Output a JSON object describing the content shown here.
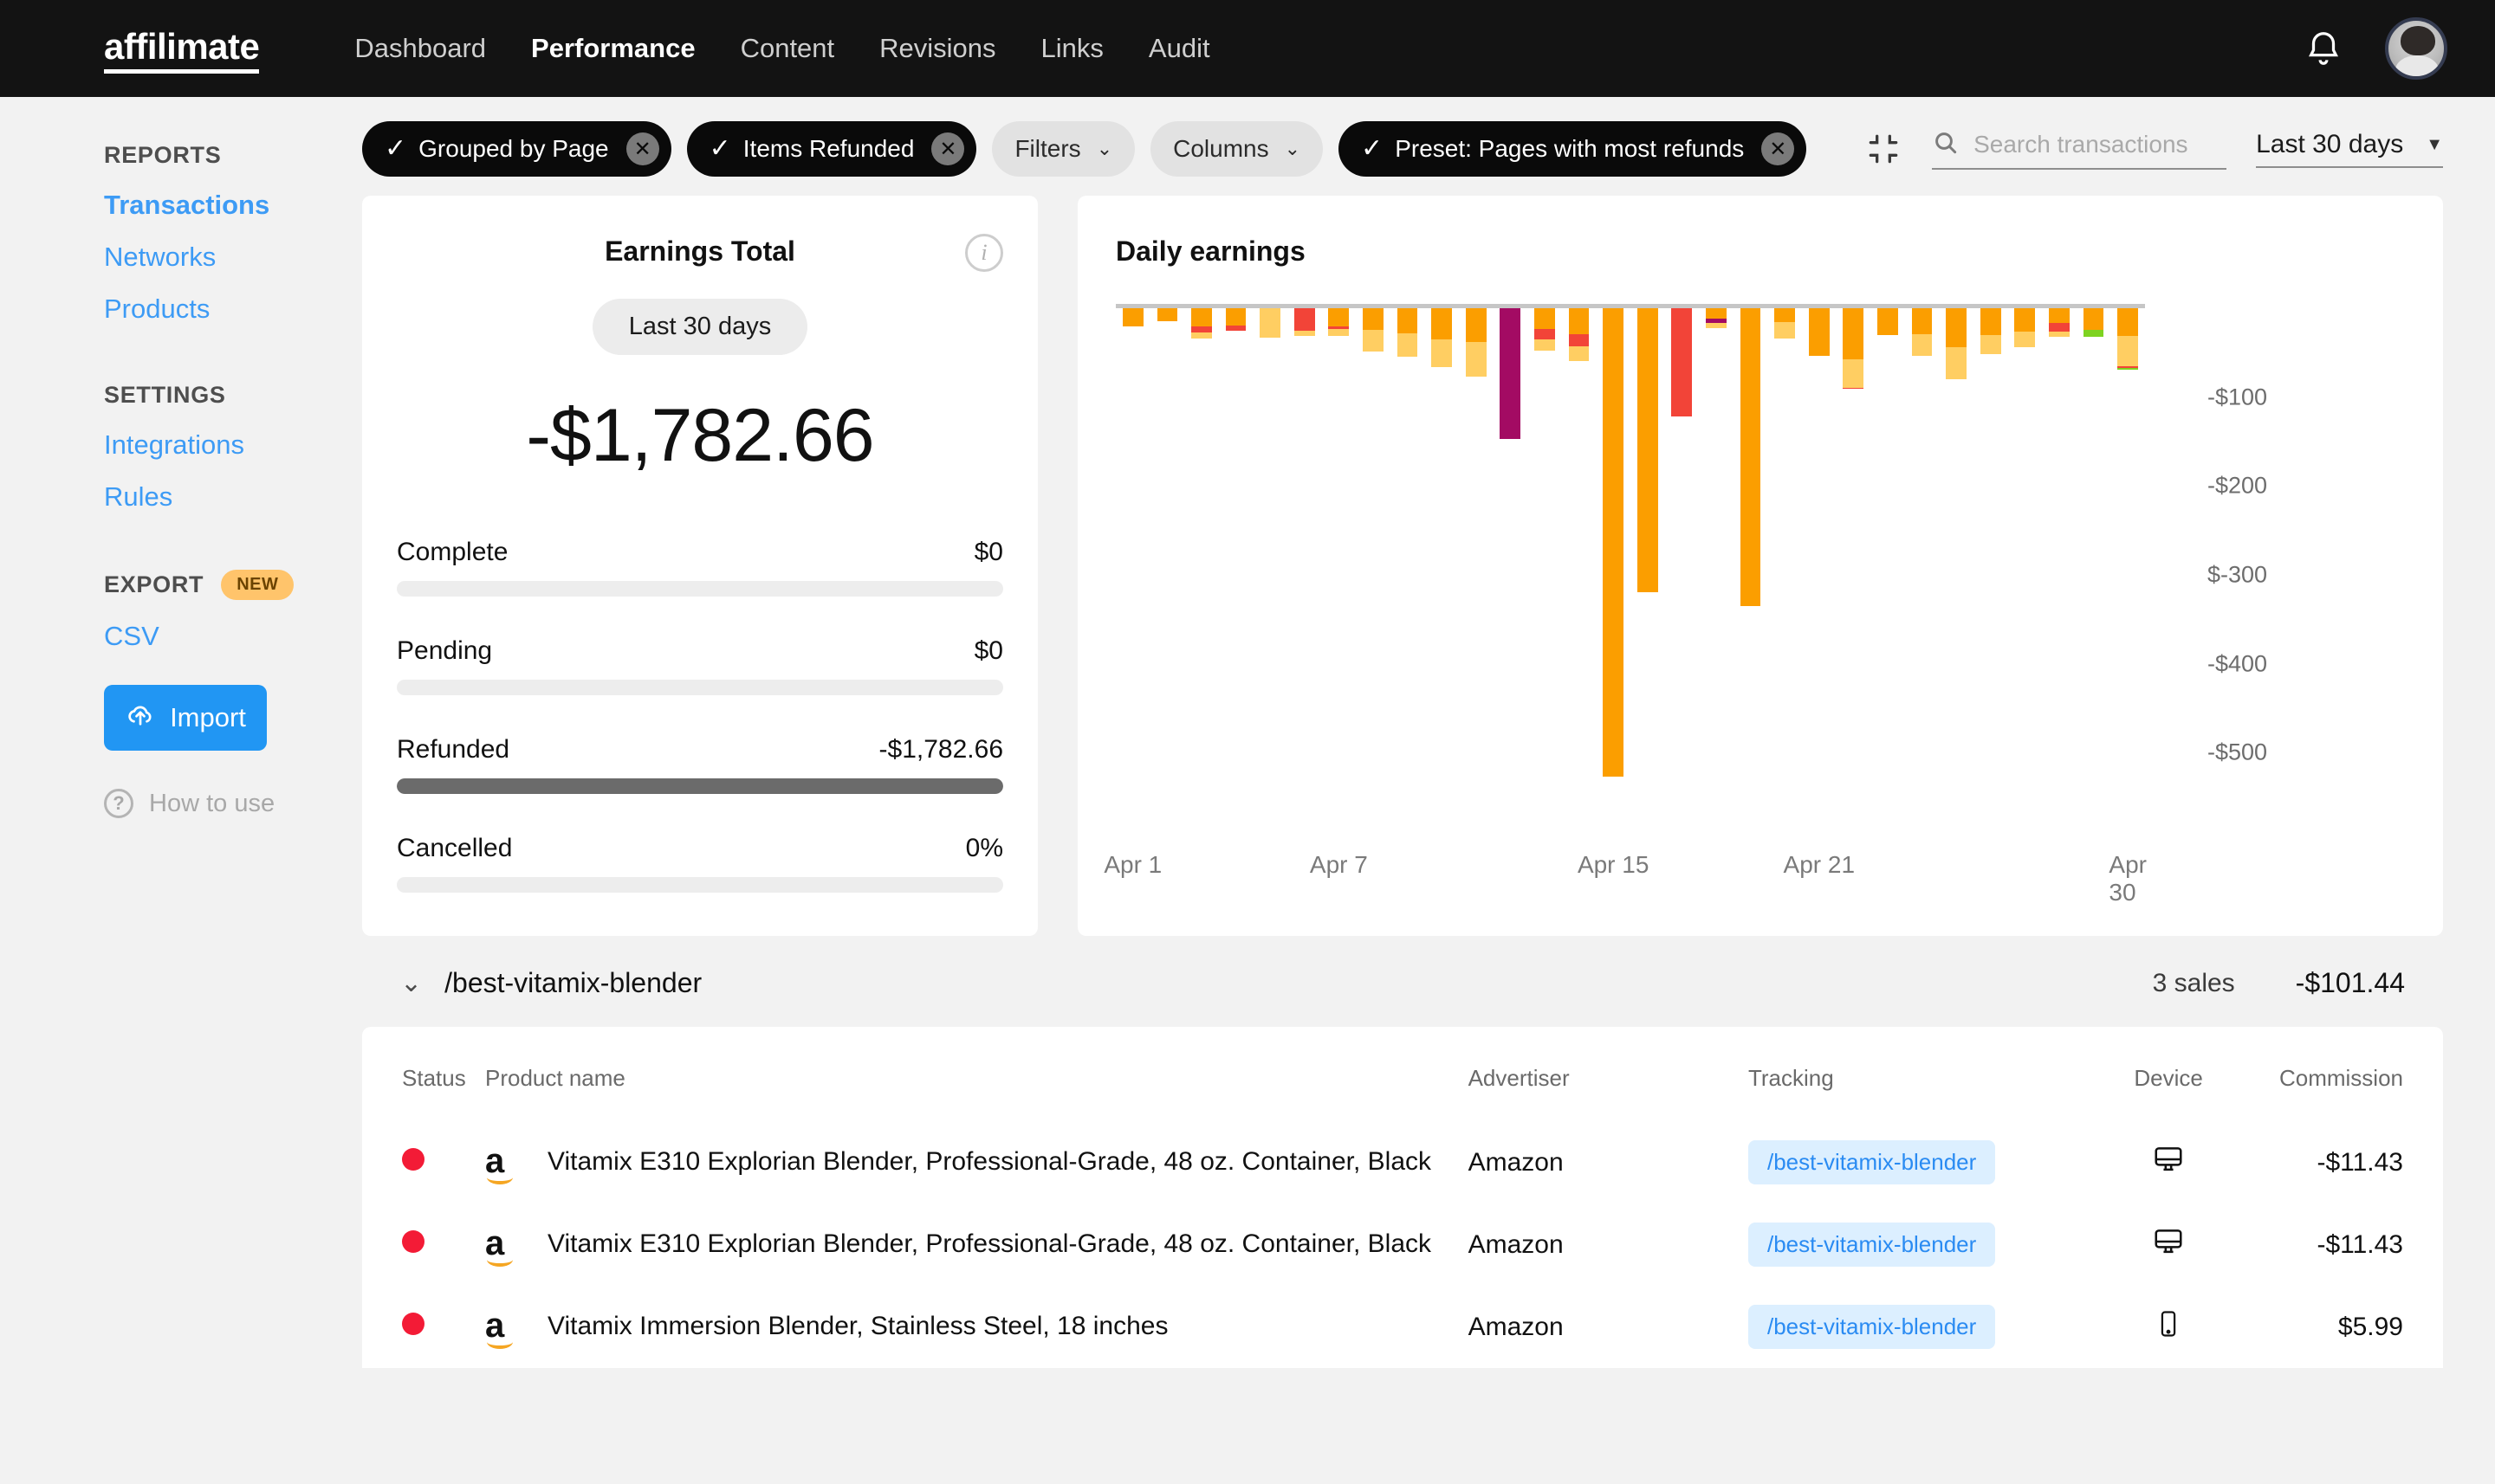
{
  "topnav": {
    "logo": "affilimate",
    "links": [
      {
        "label": "Dashboard",
        "active": false
      },
      {
        "label": "Performance",
        "active": true
      },
      {
        "label": "Content",
        "active": false
      },
      {
        "label": "Revisions",
        "active": false
      },
      {
        "label": "Links",
        "active": false
      },
      {
        "label": "Audit",
        "active": false
      }
    ],
    "bell_icon": "bell-icon",
    "avatar_icon": "user-avatar"
  },
  "sidebar": {
    "reports_heading": "REPORTS",
    "reports": [
      {
        "label": "Transactions",
        "active": true
      },
      {
        "label": "Networks",
        "active": false
      },
      {
        "label": "Products",
        "active": false
      }
    ],
    "settings_heading": "SETTINGS",
    "settings": [
      {
        "label": "Integrations",
        "active": false
      },
      {
        "label": "Rules",
        "active": false
      }
    ],
    "export_heading": "EXPORT",
    "export_badge": "NEW",
    "export_items": [
      {
        "label": "CSV",
        "active": false
      }
    ],
    "import_label": "Import",
    "how_to_use_label": "How to use"
  },
  "toolbar": {
    "chips": [
      {
        "label": "Grouped by Page",
        "style": "dark",
        "tick": true,
        "close": true
      },
      {
        "label": "Items Refunded",
        "style": "dark",
        "tick": true,
        "close": true
      },
      {
        "label": "Filters",
        "style": "light",
        "tick": false,
        "caret": true
      },
      {
        "label": "Columns",
        "style": "light",
        "tick": false,
        "caret": true
      },
      {
        "label": "Preset: Pages with most refunds",
        "style": "dark",
        "tick": true,
        "close": true
      }
    ],
    "collapse_icon": "collapse-icon",
    "search_placeholder": "Search transactions",
    "search_value": "",
    "date_range": "Last 30 days"
  },
  "earnings_card": {
    "title": "Earnings Total",
    "info_icon": "info-icon",
    "range_pill": "Last 30 days",
    "amount": "-$1,782.66",
    "stats": [
      {
        "label": "Complete",
        "value": "$0",
        "pct": 0
      },
      {
        "label": "Pending",
        "value": "$0",
        "pct": 0
      },
      {
        "label": "Refunded",
        "value": "-$1,782.66",
        "pct": 100
      },
      {
        "label": "Cancelled",
        "value": "0%",
        "pct": 0
      }
    ]
  },
  "chart_data": {
    "type": "bar",
    "title": "Daily earnings",
    "xlabel": "",
    "ylabel": "",
    "ylim": [
      -560,
      0
    ],
    "grid": false,
    "legend": false,
    "stacked": true,
    "ytick_labels": [
      "-$100",
      "-$200",
      "$-300",
      "-$400",
      "-$500"
    ],
    "ytick_values": [
      -100,
      -200,
      -300,
      -400,
      -500
    ],
    "xtick_labels": [
      "Apr 1",
      "Apr 7",
      "Apr 15",
      "Apr 21",
      "Apr 30"
    ],
    "xtick_index": [
      0,
      6,
      14,
      20,
      29
    ],
    "categories": [
      "Apr 1",
      "Apr 2",
      "Apr 3",
      "Apr 4",
      "Apr 5",
      "Apr 6",
      "Apr 7",
      "Apr 8",
      "Apr 9",
      "Apr 10",
      "Apr 11",
      "Apr 12",
      "Apr 13",
      "Apr 14",
      "Apr 15",
      "Apr 16",
      "Apr 17",
      "Apr 18",
      "Apr 19",
      "Apr 20",
      "Apr 21",
      "Apr 22",
      "Apr 23",
      "Apr 24",
      "Apr 25",
      "Apr 26",
      "Apr 27",
      "Apr 28",
      "Apr 29",
      "Apr 30"
    ],
    "colors": {
      "orange": "#fb9e00",
      "light_orange": "#ffce62",
      "red": "#f24438",
      "magenta": "#a30b63",
      "green": "#7ed321"
    },
    "values": [
      -20,
      -15,
      -34,
      -25,
      -33,
      -31,
      -31,
      -49,
      -55,
      -66,
      -77,
      -147,
      -48,
      -59,
      -527,
      -319,
      -122,
      -335,
      -22,
      -34,
      -54,
      -91,
      -30,
      -54,
      -52,
      -44,
      -32,
      -32,
      -39,
      -69
    ],
    "bars": [
      {
        "x": "Apr 1",
        "total": -20,
        "segments": [
          {
            "color": "orange",
            "value": -20
          }
        ]
      },
      {
        "x": "Apr 2",
        "total": -15,
        "segments": [
          {
            "color": "orange",
            "value": -15
          }
        ]
      },
      {
        "x": "Apr 3",
        "total": -34,
        "segments": [
          {
            "color": "orange",
            "value": -20
          },
          {
            "color": "red",
            "value": -7
          },
          {
            "color": "light_orange",
            "value": -7
          }
        ]
      },
      {
        "x": "Apr 4",
        "total": -25,
        "segments": [
          {
            "color": "orange",
            "value": -19
          },
          {
            "color": "red",
            "value": -6
          }
        ]
      },
      {
        "x": "Apr 5",
        "total": -33,
        "segments": [
          {
            "color": "light_orange",
            "value": -33
          }
        ]
      },
      {
        "x": "Apr 6",
        "total": -31,
        "segments": [
          {
            "color": "red",
            "value": -25
          },
          {
            "color": "light_orange",
            "value": -6
          }
        ]
      },
      {
        "x": "Apr 7",
        "total": -31,
        "segments": [
          {
            "color": "orange",
            "value": -20
          },
          {
            "color": "red",
            "value": -3
          },
          {
            "color": "light_orange",
            "value": -8
          }
        ]
      },
      {
        "x": "Apr 8",
        "total": -49,
        "segments": [
          {
            "color": "orange",
            "value": -24
          },
          {
            "color": "light_orange",
            "value": -25
          }
        ]
      },
      {
        "x": "Apr 9",
        "total": -55,
        "segments": [
          {
            "color": "orange",
            "value": -28
          },
          {
            "color": "light_orange",
            "value": -27
          }
        ]
      },
      {
        "x": "Apr 10",
        "total": -66,
        "segments": [
          {
            "color": "orange",
            "value": -35
          },
          {
            "color": "light_orange",
            "value": -31
          }
        ]
      },
      {
        "x": "Apr 11",
        "total": -77,
        "segments": [
          {
            "color": "orange",
            "value": -38
          },
          {
            "color": "light_orange",
            "value": -39
          }
        ]
      },
      {
        "x": "Apr 12",
        "total": -147,
        "segments": [
          {
            "color": "magenta",
            "value": -147
          }
        ]
      },
      {
        "x": "Apr 13",
        "total": -48,
        "segments": [
          {
            "color": "orange",
            "value": -23
          },
          {
            "color": "red",
            "value": -12
          },
          {
            "color": "light_orange",
            "value": -13
          }
        ]
      },
      {
        "x": "Apr 14",
        "total": -59,
        "segments": [
          {
            "color": "orange",
            "value": -29
          },
          {
            "color": "red",
            "value": -14
          },
          {
            "color": "light_orange",
            "value": -16
          }
        ]
      },
      {
        "x": "Apr 15",
        "total": -527,
        "segments": [
          {
            "color": "orange",
            "value": -527
          }
        ]
      },
      {
        "x": "Apr 16",
        "total": -319,
        "segments": [
          {
            "color": "orange",
            "value": -319
          }
        ]
      },
      {
        "x": "Apr 17",
        "total": -122,
        "segments": [
          {
            "color": "red",
            "value": -122
          }
        ]
      },
      {
        "x": "Apr 18",
        "total": -22,
        "segments": [
          {
            "color": "orange",
            "value": -12
          },
          {
            "color": "magenta",
            "value": -5
          },
          {
            "color": "light_orange",
            "value": -5
          }
        ]
      },
      {
        "x": "Apr 19",
        "total": -335,
        "segments": [
          {
            "color": "orange",
            "value": -335
          }
        ]
      },
      {
        "x": "Apr 20",
        "total": -34,
        "segments": [
          {
            "color": "orange",
            "value": -16
          },
          {
            "color": "light_orange",
            "value": -18
          }
        ]
      },
      {
        "x": "Apr 21",
        "total": -54,
        "segments": [
          {
            "color": "orange",
            "value": -54
          }
        ]
      },
      {
        "x": "Apr 22",
        "total": -91,
        "segments": [
          {
            "color": "orange",
            "value": -57
          },
          {
            "color": "light_orange",
            "value": -33
          },
          {
            "color": "red",
            "value": -1
          }
        ]
      },
      {
        "x": "Apr 23",
        "total": -30,
        "segments": [
          {
            "color": "orange",
            "value": -30
          }
        ]
      },
      {
        "x": "Apr 24",
        "total": -54,
        "segments": [
          {
            "color": "orange",
            "value": -29
          },
          {
            "color": "light_orange",
            "value": -25
          }
        ]
      },
      {
        "x": "Apr 25",
        "total": -80,
        "segments": [
          {
            "color": "orange",
            "value": -44
          },
          {
            "color": "light_orange",
            "value": -36
          }
        ]
      },
      {
        "x": "Apr 26",
        "total": -52,
        "segments": [
          {
            "color": "orange",
            "value": -30
          },
          {
            "color": "light_orange",
            "value": -22
          }
        ]
      },
      {
        "x": "Apr 27",
        "total": -44,
        "segments": [
          {
            "color": "orange",
            "value": -26
          },
          {
            "color": "light_orange",
            "value": -18
          }
        ]
      },
      {
        "x": "Apr 28",
        "total": -32,
        "segments": [
          {
            "color": "orange",
            "value": -17
          },
          {
            "color": "red",
            "value": -9
          },
          {
            "color": "light_orange",
            "value": -6
          }
        ]
      },
      {
        "x": "Apr 29",
        "total": -32,
        "segments": [
          {
            "color": "orange",
            "value": -24
          },
          {
            "color": "green",
            "value": -8
          }
        ]
      },
      {
        "x": "Apr 30",
        "total": -69,
        "segments": [
          {
            "color": "orange",
            "value": -31
          },
          {
            "color": "light_orange",
            "value": -34
          },
          {
            "color": "red",
            "value": -2
          },
          {
            "color": "green",
            "value": -2
          }
        ]
      }
    ]
  },
  "group": {
    "chevron_icon": "chevron-down-icon",
    "title": "/best-vitamix-blender",
    "sales": "3 sales",
    "amount": "-$101.44"
  },
  "table": {
    "columns": [
      "Status",
      "Product name",
      "Advertiser",
      "Tracking",
      "Device",
      "Commission"
    ],
    "rows": [
      {
        "status": "refunded",
        "network_icon": "amazon-icon",
        "product": "Vitamix E310 Explorian Blender, Professional-Grade, 48 oz. Container, Black",
        "advertiser": "Amazon",
        "tracking": "/best-vitamix-blender",
        "device": "desktop-icon",
        "commission": "-$11.43"
      },
      {
        "status": "refunded",
        "network_icon": "amazon-icon",
        "product": "Vitamix E310 Explorian Blender, Professional-Grade, 48 oz. Container, Black",
        "advertiser": "Amazon",
        "tracking": "/best-vitamix-blender",
        "device": "desktop-icon",
        "commission": "-$11.43"
      },
      {
        "status": "refunded",
        "network_icon": "amazon-icon",
        "product": "Vitamix Immersion Blender, Stainless Steel, 18 inches",
        "advertiser": "Amazon",
        "tracking": "/best-vitamix-blender",
        "device": "mobile-icon",
        "commission": "$5.99"
      }
    ]
  }
}
